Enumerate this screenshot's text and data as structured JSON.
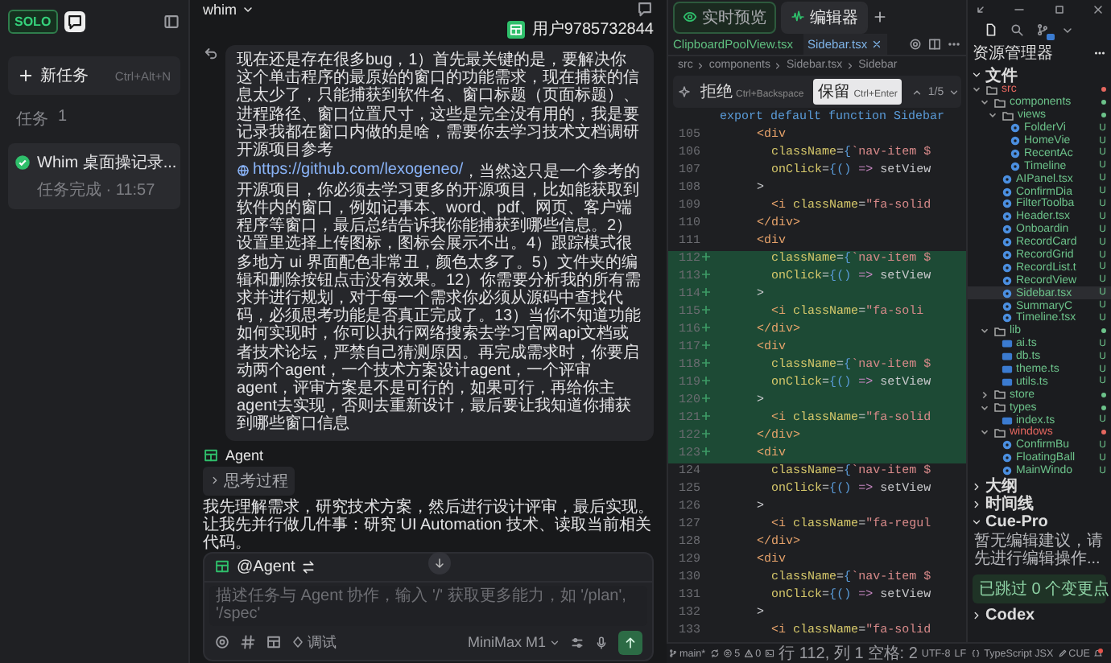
{
  "app": {
    "logo": "SOLO"
  },
  "sidebar": {
    "new_task": {
      "label": "新任务",
      "shortcut": "Ctrl+Alt+N"
    },
    "section": "任务",
    "count": "1",
    "tasks": [
      {
        "title": "Whim 桌面操记录...",
        "meta": "任务完成 · 11:57",
        "selected": true,
        "done": true
      }
    ]
  },
  "chat": {
    "project": "whim",
    "user": "用户9785732844",
    "message": [
      {
        "text": "现在还是存在很多bug，1）首先最关键的是，要解决你这个单击程序的最原始的窗口的功能需求，现在捕获的信息太少了，只能捕获到软件名、窗口标题（页面标题）、进程路径、窗口位置尺寸，这些是完全没有用的，我是要记录我都在窗口内做的是啥，需要你去学习技术文档调研开源项目参考"
      },
      {
        "link": "https://github.com/lexogeneo/",
        "text": "，当然这只是一个参考的开源项目，你必须去学习更多的开源项目，比如能获取到软件内的窗口，例如记事本、word、pdf、网页、客户端程序等窗口，最后总结告诉我你能捕获到哪些信息。2）设置里选择上传图标，图标会展示不出。4）跟踪模式很多地方 ui 界面配色非常丑，颜色太多了。5）文件夹的编辑和删除按钮点击没有效果。12）你需要分析我的所有需求并进行规划，对于每一个需求你必须从源码中查找代码，必须思考功能是否真正完成了。13）当你不知道功能如何实现时，你可以执行网络搜索去学习官网api文档或者技术论坛，严禁自己猜测原因。再完成需求时，你要启动两个agent，一个技术方案设计agent，一个评审agent，评审方案是不是可行的，如果可行，再给你主agent去实现，否则去重新设计，最后要让我知道你捕获到哪些窗口信息"
      }
    ],
    "agent": {
      "name": "Agent",
      "thinking": "思考过程",
      "reply": "我先理解需求，研究技术方案，然后进行设计评审，最后实现。让我先并行做几件事：研究 UI Automation 技术、读取当前相关代码。"
    },
    "composer": {
      "mention": "@Agent",
      "placeholder": "描述任务与 Agent 协作，输入 '/' 获取更多能力，如 '/plan', '/spec'",
      "mode": "调试",
      "model": "MiniMax M1"
    }
  },
  "editor": {
    "tabs": [
      {
        "label": "实时预览",
        "selected": false
      },
      {
        "label": "编辑器",
        "selected": true
      }
    ],
    "files": [
      {
        "name": "ClipboardPoolView.tsx",
        "selected": false,
        "color": "#5fbf7f"
      },
      {
        "name": "Sidebar.tsx",
        "selected": true,
        "color": "#7fb4e8"
      }
    ],
    "breadcrumb": [
      "src",
      "components",
      "Sidebar.tsx",
      "Sidebar"
    ],
    "diff": {
      "reject": "拒绝",
      "reject_key": "Ctrl+Backspace",
      "keep": "保留",
      "keep_key": "Ctrl+Enter",
      "position": "1/5"
    },
    "sticky": "export default function Sidebar",
    "lines": [
      {
        "n": "105",
        "text": "      <div",
        "added": false
      },
      {
        "n": "106",
        "text": "        className={`nav-item $",
        "added": false
      },
      {
        "n": "107",
        "text": "        onClick={() => setView",
        "added": false
      },
      {
        "n": "108",
        "text": "      >",
        "added": false
      },
      {
        "n": "109",
        "text": "        <i className=\"fa-solid",
        "added": false
      },
      {
        "n": "110",
        "text": "      </div>",
        "added": false
      },
      {
        "n": "111",
        "text": "      <div",
        "added": false
      },
      {
        "n": "112",
        "text": "        className={`nav-item $",
        "added": true
      },
      {
        "n": "113",
        "text": "        onClick={() => setView",
        "added": true
      },
      {
        "n": "114",
        "text": "      >",
        "added": true
      },
      {
        "n": "115",
        "text": "        <i className=\"fa-soli",
        "added": true
      },
      {
        "n": "116",
        "text": "      </div>",
        "added": true
      },
      {
        "n": "117",
        "text": "      <div",
        "added": true
      },
      {
        "n": "118",
        "text": "        className={`nav-item $",
        "added": true
      },
      {
        "n": "119",
        "text": "        onClick={() => setView",
        "added": true
      },
      {
        "n": "120",
        "text": "      >",
        "added": true
      },
      {
        "n": "121",
        "text": "        <i className=\"fa-solid",
        "added": true
      },
      {
        "n": "122",
        "text": "      </div>",
        "added": true
      },
      {
        "n": "123",
        "text": "      <div",
        "added": true
      },
      {
        "n": "124",
        "text": "        className={`nav-item $",
        "added": false
      },
      {
        "n": "125",
        "text": "        onClick={() => setView",
        "added": false
      },
      {
        "n": "126",
        "text": "      >",
        "added": false
      },
      {
        "n": "127",
        "text": "        <i className=\"fa-regul",
        "added": false
      },
      {
        "n": "128",
        "text": "      </div>",
        "added": false
      },
      {
        "n": "129",
        "text": "      <div",
        "added": false
      },
      {
        "n": "130",
        "text": "        className={`nav-item $",
        "added": false
      },
      {
        "n": "131",
        "text": "        onClick={() => setView",
        "added": false
      },
      {
        "n": "132",
        "text": "      >",
        "added": false
      },
      {
        "n": "133",
        "text": "        <i className=\"fa-solid",
        "added": false
      }
    ]
  },
  "explorer": {
    "title": "资源管理器",
    "files": {
      "label": "文件",
      "expanded": true
    },
    "tree": [
      {
        "name": "src",
        "kind": "folder",
        "expanded": true,
        "selected": false,
        "color": "#e5675f",
        "children": [
          {
            "name": "components",
            "kind": "folder",
            "expanded": true,
            "selected": false,
            "color": "#6cc28a",
            "children": [
              {
                "name": "views",
                "kind": "folder",
                "expanded": true,
                "selected": false,
                "color": "#6cc28a",
                "children": [
                  {
                    "name": "FolderVi",
                    "kind": "tsx",
                    "badge": "U",
                    "selected": false,
                    "color": "#6cc28a"
                  },
                  {
                    "name": "HomeVie",
                    "kind": "tsx",
                    "badge": "U",
                    "selected": false,
                    "color": "#6cc28a"
                  },
                  {
                    "name": "RecentAc",
                    "kind": "tsx",
                    "badge": "U",
                    "selected": false,
                    "color": "#6cc28a"
                  },
                  {
                    "name": "Timeline",
                    "kind": "tsx",
                    "badge": "U",
                    "selected": false,
                    "color": "#6cc28a"
                  }
                ]
              },
              {
                "name": "AIPanel.tsx",
                "kind": "tsx",
                "badge": "U",
                "selected": false,
                "color": "#6cc28a"
              },
              {
                "name": "ConfirmDia",
                "kind": "tsx",
                "badge": "U",
                "selected": false,
                "color": "#6cc28a"
              },
              {
                "name": "FilterToolba",
                "kind": "tsx",
                "badge": "U",
                "selected": false,
                "color": "#6cc28a"
              },
              {
                "name": "Header.tsx",
                "kind": "tsx",
                "badge": "U",
                "selected": false,
                "color": "#6cc28a"
              },
              {
                "name": "Onboardin",
                "kind": "tsx",
                "badge": "U",
                "selected": false,
                "color": "#6cc28a"
              },
              {
                "name": "RecordCard",
                "kind": "tsx",
                "badge": "U",
                "selected": false,
                "color": "#6cc28a"
              },
              {
                "name": "RecordGrid",
                "kind": "tsx",
                "badge": "U",
                "selected": false,
                "color": "#6cc28a"
              },
              {
                "name": "RecordList.t",
                "kind": "tsx",
                "badge": "U",
                "selected": false,
                "color": "#6cc28a"
              },
              {
                "name": "RecordView",
                "kind": "tsx",
                "badge": "U",
                "selected": false,
                "color": "#6cc28a"
              },
              {
                "name": "Sidebar.tsx",
                "kind": "tsx",
                "badge": "U",
                "selected": true,
                "color": "#6cc28a"
              },
              {
                "name": "SummaryC",
                "kind": "tsx",
                "badge": "U",
                "selected": false,
                "color": "#6cc28a"
              },
              {
                "name": "Timeline.tsx",
                "kind": "tsx",
                "badge": "U",
                "selected": false,
                "color": "#6cc28a"
              }
            ]
          },
          {
            "name": "lib",
            "kind": "folder",
            "expanded": true,
            "selected": false,
            "color": "#6cc28a",
            "children": [
              {
                "name": "ai.ts",
                "kind": "ts",
                "badge": "U",
                "selected": false,
                "color": "#6cc28a"
              },
              {
                "name": "db.ts",
                "kind": "ts",
                "badge": "U",
                "selected": false,
                "color": "#6cc28a"
              },
              {
                "name": "theme.ts",
                "kind": "ts",
                "badge": "U",
                "selected": false,
                "color": "#6cc28a"
              },
              {
                "name": "utils.ts",
                "kind": "ts",
                "badge": "U",
                "selected": false,
                "color": "#6cc28a"
              }
            ]
          },
          {
            "name": "store",
            "kind": "folder",
            "expanded": false,
            "selected": false,
            "color": "#6cc28a"
          },
          {
            "name": "types",
            "kind": "folder",
            "expanded": true,
            "selected": false,
            "color": "#6cc28a",
            "children": [
              {
                "name": "index.ts",
                "kind": "ts",
                "badge": "U",
                "selected": false,
                "color": "#6cc28a"
              }
            ]
          },
          {
            "name": "windows",
            "kind": "folder",
            "expanded": true,
            "selected": false,
            "color": "#e5675f",
            "children": [
              {
                "name": "ConfirmBu",
                "kind": "tsx",
                "badge": "U",
                "selected": false,
                "color": "#6cc28a"
              },
              {
                "name": "FloatingBall",
                "kind": "tsx",
                "badge": "U",
                "selected": false,
                "color": "#6cc28a"
              },
              {
                "name": "MainWindo",
                "kind": "tsx",
                "badge": "U",
                "selected": false,
                "color": "#6cc28a"
              }
            ]
          }
        ]
      }
    ],
    "sections": [
      {
        "label": "大纲",
        "expanded": false
      },
      {
        "label": "时间线",
        "expanded": false
      },
      {
        "label": "Cue-Pro",
        "expanded": true,
        "text": "暂无编辑建议，请先进行编辑操作...",
        "button": "已跳过 0 个变更点"
      },
      {
        "label": "Codex",
        "expanded": false
      }
    ]
  },
  "status": {
    "branch": "main*",
    "errors": "5",
    "warnings": "0",
    "position": "行 112, 列 1",
    "indent": "空格: 2",
    "encoding": "UTF-8",
    "eol": "LF",
    "language": "TypeScript JSX",
    "extension": "CUE"
  }
}
